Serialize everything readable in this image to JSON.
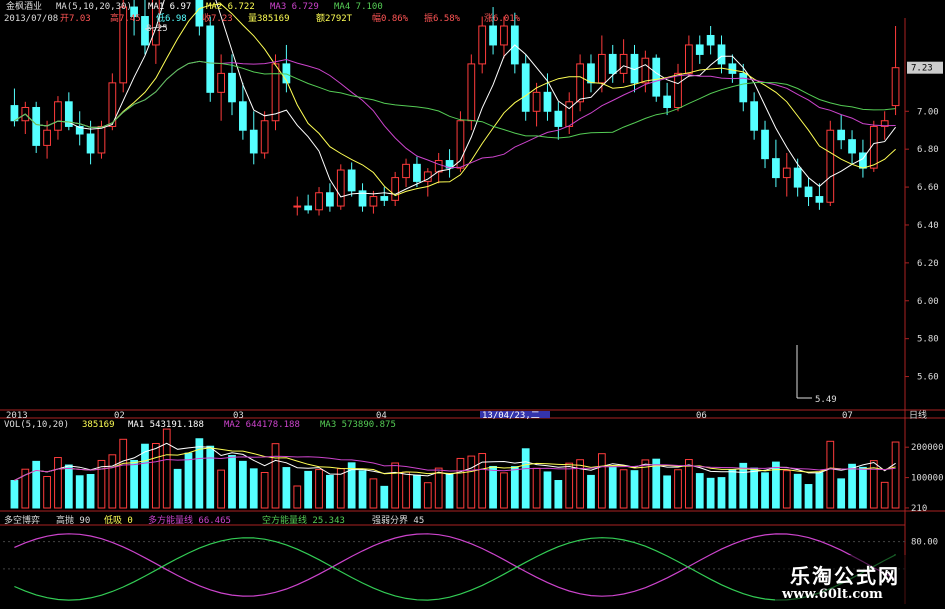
{
  "colors": {
    "up": "#ff3c3c",
    "down": "#55ffff",
    "ma1": "#ffffff",
    "ma2": "#ffff55",
    "ma3": "#cc44cc",
    "ma4": "#55cc55",
    "axis": "#aa2222",
    "multi_line": "#cc44cc",
    "short_line": "#33cc55"
  },
  "header": {
    "stock_name": "金枫酒业",
    "ma_label": "MA(5,10,20,30)",
    "ma1": "MA1 6.97",
    "ma2": "MA2 6.722",
    "ma3": "MA3 6.729",
    "ma4": "MA4 7.100",
    "date": "2013/07/08",
    "open": "开7.03",
    "high": "高7.45",
    "low": "低6.98",
    "close": "收7.23",
    "volume": "量385169",
    "amount": "额2792T",
    "change": "幅0.86%",
    "amplitude": "振6.58%",
    "pct": "涨6.01%"
  },
  "price_panel": {
    "y_ticks": [
      "7.00",
      "6.80",
      "6.60",
      "6.40",
      "6.20",
      "6.00",
      "5.80",
      "5.60"
    ],
    "high_marker": "8.25",
    "low_marker": "5.49",
    "current_tag": "7.23"
  },
  "time_axis": {
    "labels": [
      "2013",
      "02",
      "03",
      "04",
      "13/04/23,二",
      "06",
      "07"
    ],
    "period": "日线"
  },
  "volume_panel": {
    "label": "VOL(5,10,20)",
    "value": "385169",
    "ma1": "MA1 543191.188",
    "ma2": "MA2 644178.188",
    "ma3": "MA3 573890.875",
    "y_ticks": [
      "200000",
      "100000",
      "210"
    ]
  },
  "indicator_panel": {
    "name": "多空博弈",
    "high": "高抛 90",
    "low": "低吸 0",
    "multi": "多方能量线 66.465",
    "short": "空方能量线 25.343",
    "strength": "强弱分界 45",
    "y_ticks": [
      "80.00"
    ]
  },
  "watermark": {
    "title": "乐淘公式网",
    "url": "www.60lt.com"
  },
  "chart_data": {
    "type": "candlestick",
    "x": [
      "2013",
      "02",
      "03",
      "04",
      "13/04/23,二",
      "06",
      "07"
    ],
    "candles": [
      [
        7.03,
        7.12,
        6.92,
        6.95
      ],
      [
        6.95,
        7.05,
        6.88,
        7.02
      ],
      [
        7.02,
        7.05,
        6.78,
        6.82
      ],
      [
        6.82,
        6.95,
        6.75,
        6.9
      ],
      [
        6.9,
        7.08,
        6.85,
        7.05
      ],
      [
        7.05,
        7.1,
        6.9,
        6.92
      ],
      [
        6.92,
        7.0,
        6.82,
        6.88
      ],
      [
        6.88,
        6.95,
        6.72,
        6.78
      ],
      [
        6.78,
        6.95,
        6.75,
        6.92
      ],
      [
        6.92,
        7.2,
        6.9,
        7.15
      ],
      [
        7.15,
        7.6,
        7.1,
        7.55
      ],
      [
        7.55,
        7.95,
        7.4,
        7.5
      ],
      [
        7.5,
        7.8,
        7.3,
        7.35
      ],
      [
        7.35,
        7.7,
        7.25,
        7.65
      ],
      [
        7.65,
        8.25,
        7.6,
        8.1
      ],
      [
        8.1,
        8.15,
        7.85,
        7.95
      ],
      [
        7.95,
        8.05,
        7.7,
        7.8
      ],
      [
        7.8,
        7.9,
        7.4,
        7.45
      ],
      [
        7.45,
        7.5,
        7.05,
        7.1
      ],
      [
        7.1,
        7.3,
        6.95,
        7.2
      ],
      [
        7.2,
        7.3,
        6.98,
        7.05
      ],
      [
        7.05,
        7.15,
        6.85,
        6.9
      ],
      [
        6.9,
        7.0,
        6.72,
        6.78
      ],
      [
        6.78,
        7.0,
        6.75,
        6.95
      ],
      [
        6.95,
        7.3,
        6.9,
        7.25
      ],
      [
        7.25,
        7.35,
        7.1,
        7.15
      ],
      [
        6.5,
        6.55,
        6.45,
        6.5
      ],
      [
        6.5,
        6.56,
        6.46,
        6.48
      ],
      [
        6.48,
        6.6,
        6.45,
        6.57
      ],
      [
        6.57,
        6.62,
        6.47,
        6.5
      ],
      [
        6.5,
        6.72,
        6.48,
        6.69
      ],
      [
        6.69,
        6.73,
        6.55,
        6.58
      ],
      [
        6.58,
        6.62,
        6.47,
        6.5
      ],
      [
        6.5,
        6.58,
        6.46,
        6.55
      ],
      [
        6.55,
        6.6,
        6.5,
        6.53
      ],
      [
        6.53,
        6.68,
        6.5,
        6.65
      ],
      [
        6.65,
        6.75,
        6.6,
        6.72
      ],
      [
        6.72,
        6.76,
        6.6,
        6.63
      ],
      [
        6.63,
        6.7,
        6.55,
        6.68
      ],
      [
        6.68,
        6.78,
        6.62,
        6.74
      ],
      [
        6.74,
        6.8,
        6.65,
        6.7
      ],
      [
        6.7,
        7.0,
        6.68,
        6.95
      ],
      [
        6.95,
        7.3,
        6.9,
        7.25
      ],
      [
        7.25,
        7.5,
        7.2,
        7.45
      ],
      [
        7.45,
        7.55,
        7.3,
        7.35
      ],
      [
        7.35,
        7.5,
        7.28,
        7.45
      ],
      [
        7.45,
        7.52,
        7.2,
        7.25
      ],
      [
        7.25,
        7.3,
        6.95,
        7.0
      ],
      [
        7.0,
        7.15,
        6.92,
        7.1
      ],
      [
        7.1,
        7.2,
        6.95,
        7.0
      ],
      [
        7.0,
        7.05,
        6.85,
        6.92
      ],
      [
        6.92,
        7.1,
        6.88,
        7.05
      ],
      [
        7.05,
        7.3,
        7.0,
        7.25
      ],
      [
        7.25,
        7.3,
        7.1,
        7.15
      ],
      [
        7.15,
        7.4,
        7.1,
        7.3
      ],
      [
        7.3,
        7.35,
        7.15,
        7.2
      ],
      [
        7.2,
        7.38,
        7.15,
        7.3
      ],
      [
        7.3,
        7.35,
        7.1,
        7.15
      ],
      [
        7.15,
        7.32,
        7.1,
        7.28
      ],
      [
        7.28,
        7.3,
        7.05,
        7.08
      ],
      [
        7.08,
        7.15,
        6.98,
        7.02
      ],
      [
        7.02,
        7.25,
        7.0,
        7.2
      ],
      [
        7.2,
        7.4,
        7.18,
        7.35
      ],
      [
        7.35,
        7.4,
        7.25,
        7.3
      ],
      [
        7.4,
        7.45,
        7.3,
        7.35
      ],
      [
        7.35,
        7.4,
        7.2,
        7.25
      ],
      [
        7.25,
        7.3,
        7.15,
        7.2
      ],
      [
        7.2,
        7.25,
        7.0,
        7.05
      ],
      [
        7.05,
        7.1,
        6.85,
        6.9
      ],
      [
        6.9,
        6.95,
        6.7,
        6.75
      ],
      [
        6.75,
        6.85,
        6.6,
        6.65
      ],
      [
        6.65,
        6.78,
        6.55,
        6.7
      ],
      [
        6.7,
        6.75,
        6.55,
        6.6
      ],
      [
        6.6,
        6.65,
        6.5,
        6.55
      ],
      [
        6.55,
        6.62,
        6.48,
        6.52
      ],
      [
        6.52,
        6.95,
        6.5,
        6.9
      ],
      [
        6.9,
        6.98,
        6.8,
        6.85
      ],
      [
        6.85,
        6.9,
        6.72,
        6.78
      ],
      [
        6.78,
        6.85,
        6.65,
        6.7
      ],
      [
        6.7,
        6.95,
        6.68,
        6.92
      ],
      [
        6.92,
        7.0,
        6.85,
        6.95
      ],
      [
        7.03,
        7.45,
        6.98,
        7.23
      ]
    ],
    "volume_ylim": [
      0,
      250000
    ],
    "price_ylim": [
      5.45,
      7.45
    ]
  }
}
